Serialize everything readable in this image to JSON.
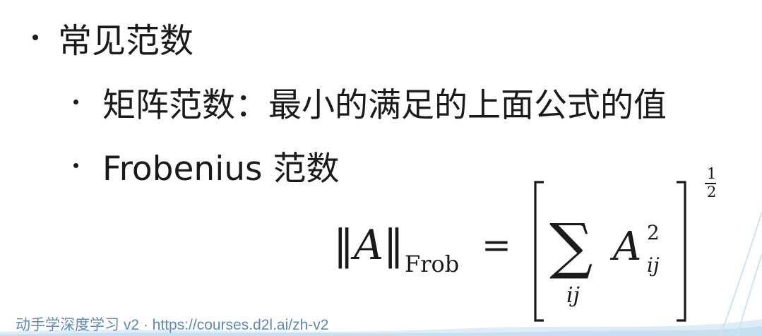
{
  "slide": {
    "heading": "常见范数",
    "bullets": [
      "矩阵范数：最小的满足的上面公式的值",
      "Frobenius 范数"
    ]
  },
  "formula": {
    "norm_open": "‖",
    "norm_var": "A",
    "norm_close": "‖",
    "norm_subscript": "Frob",
    "equals": "=",
    "sum_symbol": "∑",
    "sum_index": "ij",
    "term_var": "A",
    "term_sup": "2",
    "term_sub": "ij",
    "exponent_numerator": "1",
    "exponent_denominator": "2"
  },
  "footer": {
    "text": "动手学深度学习 v2 · https://courses.d2l.ai/zh-v2"
  },
  "colors": {
    "text": "#1a1a1a",
    "footer": "#5c89b8",
    "wave": "#cfe3f2"
  }
}
